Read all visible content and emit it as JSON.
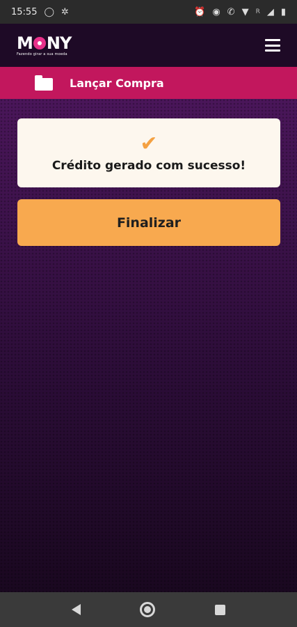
{
  "status_bar": {
    "time": "15:55",
    "left_icons": [
      "whatsapp-icon",
      "usb-debug-icon"
    ],
    "right_icons": [
      "alarm-icon",
      "eye-icon",
      "wifi-calling-icon",
      "wifi-icon",
      "signal-icon",
      "battery-icon"
    ],
    "network_label": "R"
  },
  "header": {
    "logo_text_left": "M",
    "logo_text_right": "NY",
    "logo_tagline": "Fazendo girar a sua moeda",
    "menu_icon": "hamburger-menu-icon"
  },
  "section": {
    "icon": "folder-icon",
    "title": "Lançar Compra"
  },
  "success_card": {
    "icon": "checkmark-icon",
    "message": "Crédito gerado com sucesso!"
  },
  "actions": {
    "finalizar_label": "Finalizar"
  },
  "colors": {
    "section_bar": "#c2175d",
    "accent_orange": "#f8a94f",
    "card_bg": "#fdf7ee",
    "background_purple": "#3b1247"
  }
}
